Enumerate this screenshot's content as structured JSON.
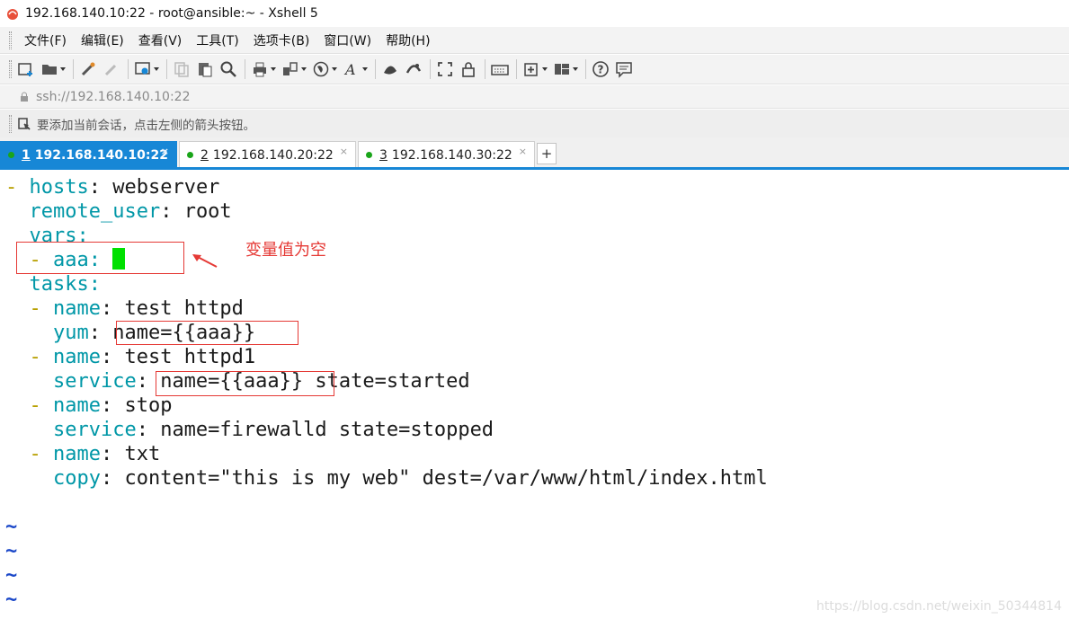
{
  "window": {
    "title": "192.168.140.10:22 - root@ansible:~ - Xshell 5"
  },
  "menu": [
    "文件(F)",
    "编辑(E)",
    "查看(V)",
    "工具(T)",
    "选项卡(B)",
    "窗口(W)",
    "帮助(H)"
  ],
  "address": "ssh://192.168.140.10:22",
  "hint": "要添加当前会话，点击左侧的箭头按钮。",
  "tabs": [
    {
      "num": "1",
      "label": "192.168.140.10:22",
      "active": true
    },
    {
      "num": "2",
      "label": "192.168.140.20:22",
      "active": false
    },
    {
      "num": "3",
      "label": "192.168.140.30:22",
      "active": false
    }
  ],
  "tab_add": "+",
  "tab_close": "×",
  "terminal": {
    "l1": {
      "dash": "- ",
      "key": "hosts",
      "rest": ": webserver"
    },
    "l2": {
      "key": "remote_user",
      "rest": ": root"
    },
    "l3": {
      "key": "vars",
      "rest": ":"
    },
    "l4": {
      "dash": "- ",
      "key": "aaa",
      "rest": ": "
    },
    "l5": {
      "key": "tasks",
      "rest": ":"
    },
    "l6": {
      "dash": "- ",
      "key": "name",
      "rest": ": test httpd"
    },
    "l7": {
      "key": "yum",
      "rest": ": name={{aaa}}"
    },
    "l8": {
      "dash": "- ",
      "key": "name",
      "rest": ": test httpd1"
    },
    "l9": {
      "key": "service",
      "rest": ": name={{aaa}} state=started"
    },
    "l10": {
      "dash": "- ",
      "key": "name",
      "rest": ": stop"
    },
    "l11": {
      "key": "service",
      "rest": ": name=firewalld state=stopped"
    },
    "l12": {
      "dash": "- ",
      "key": "name",
      "rest": ": txt"
    },
    "l13": {
      "key": "copy",
      "rest": ": content=\"this is my web\" dest=/var/www/html/index.html"
    },
    "tilde": "~"
  },
  "annotation": {
    "label": "变量值为空"
  },
  "watermark": "https://blog.csdn.net/weixin_50344814",
  "colors": {
    "accent": "#1787d6",
    "key": "#0097a7",
    "dash": "#b8a000",
    "tilde": "#1a47c8",
    "annotation": "#e53935",
    "cursor": "#00e000"
  }
}
